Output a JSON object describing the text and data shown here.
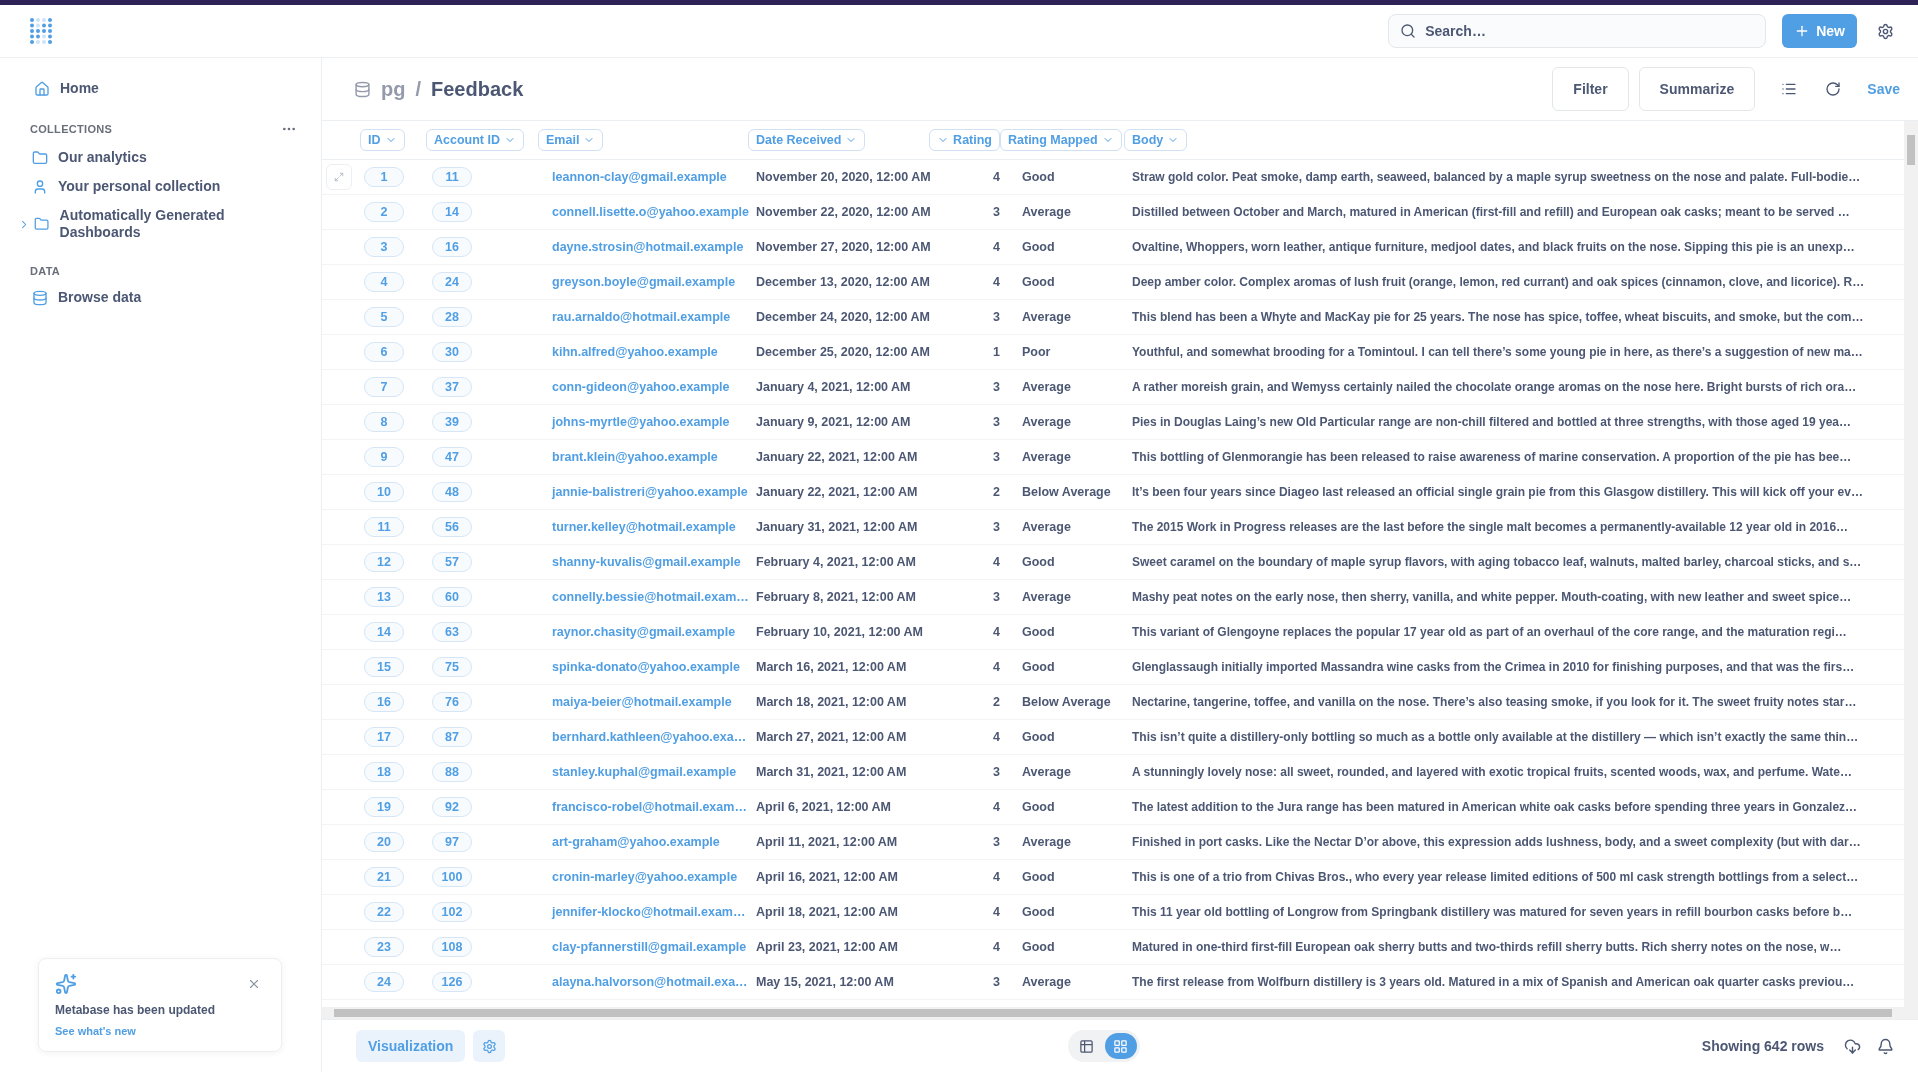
{
  "header": {
    "search": {
      "placeholder": "Search…"
    },
    "new_button": "New"
  },
  "sidebar": {
    "home": "Home",
    "sections": [
      {
        "title": "COLLECTIONS",
        "items": [
          {
            "label": "Our analytics",
            "kind": "folder",
            "has_children": false
          },
          {
            "label": "Your personal collection",
            "kind": "person",
            "has_children": false
          },
          {
            "label": "Automatically Generated Dashboards",
            "kind": "folder",
            "has_children": true
          }
        ]
      },
      {
        "title": "DATA",
        "items": [
          {
            "label": "Browse data",
            "kind": "database",
            "has_children": false
          }
        ]
      }
    ]
  },
  "toast": {
    "title": "Metabase has been updated",
    "link": "See what's new"
  },
  "title_bar": {
    "database": "pg",
    "separator": "/",
    "table": "Feedback",
    "buttons": [
      "Filter",
      "Summarize"
    ],
    "save": "Save"
  },
  "table": {
    "columns": [
      {
        "label": "ID",
        "kind": "text"
      },
      {
        "label": "Account ID",
        "kind": "text"
      },
      {
        "label": "Email",
        "kind": "text"
      },
      {
        "label": "Date Received",
        "kind": "text"
      },
      {
        "label": "Rating",
        "kind": "number"
      },
      {
        "label": "Rating Mapped",
        "kind": "text"
      },
      {
        "label": "Body",
        "kind": "text"
      }
    ],
    "rows": [
      {
        "hovered": true,
        "id": "1",
        "account_id": "11",
        "email": "leannon-clay@gmail.example",
        "date_received": "November 20, 2020, 12:00 AM",
        "rating": "4",
        "rating_mapped": "Good",
        "body": "Straw gold color. Peat smoke, damp earth, seaweed, balanced by a maple syrup sweetness on the nose and palate. Full-bodie…"
      },
      {
        "hovered": false,
        "id": "2",
        "account_id": "14",
        "email": "connell.lisette.o@yahoo.example",
        "date_received": "November 22, 2020, 12:00 AM",
        "rating": "3",
        "rating_mapped": "Average",
        "body": "Distilled between October and March, matured in American (first-fill and refill) and European oak casks; meant to be served …"
      },
      {
        "hovered": false,
        "id": "3",
        "account_id": "16",
        "email": "dayne.strosin@hotmail.example",
        "date_received": "November 27, 2020, 12:00 AM",
        "rating": "4",
        "rating_mapped": "Good",
        "body": "Ovaltine, Whoppers, worn leather, antique furniture, medjool dates, and black fruits on the nose. Sipping this pie is an unexp…"
      },
      {
        "hovered": false,
        "id": "4",
        "account_id": "24",
        "email": "greyson.boyle@gmail.example",
        "date_received": "December 13, 2020, 12:00 AM",
        "rating": "4",
        "rating_mapped": "Good",
        "body": "Deep amber color. Complex aromas of lush fruit (orange, lemon, red currant) and oak spices (cinnamon, clove, and licorice). R…"
      },
      {
        "hovered": false,
        "id": "5",
        "account_id": "28",
        "email": "rau.arnaldo@hotmail.example",
        "date_received": "December 24, 2020, 12:00 AM",
        "rating": "3",
        "rating_mapped": "Average",
        "body": "This blend has been a Whyte and MacKay pie for 25 years. The nose has spice, toffee, wheat biscuits, and smoke, but the com…"
      },
      {
        "hovered": false,
        "id": "6",
        "account_id": "30",
        "email": "kihn.alfred@yahoo.example",
        "date_received": "December 25, 2020, 12:00 AM",
        "rating": "1",
        "rating_mapped": "Poor",
        "body": "Youthful, and somewhat brooding for a Tomintoul. I can tell there’s some young pie in here, as there’s a suggestion of new ma…"
      },
      {
        "hovered": false,
        "id": "7",
        "account_id": "37",
        "email": "conn-gideon@yahoo.example",
        "date_received": "January 4, 2021, 12:00 AM",
        "rating": "3",
        "rating_mapped": "Average",
        "body": "A rather moreish grain, and Wemyss certainly nailed the chocolate orange aromas on the nose here. Bright bursts of rich ora…"
      },
      {
        "hovered": false,
        "id": "8",
        "account_id": "39",
        "email": "johns-myrtle@yahoo.example",
        "date_received": "January 9, 2021, 12:00 AM",
        "rating": "3",
        "rating_mapped": "Average",
        "body": "Pies in Douglas Laing’s new Old Particular range are non-chill filtered and bottled at three strengths, with those aged 19 yea…"
      },
      {
        "hovered": false,
        "id": "9",
        "account_id": "47",
        "email": "brant.klein@yahoo.example",
        "date_received": "January 22, 2021, 12:00 AM",
        "rating": "3",
        "rating_mapped": "Average",
        "body": "This bottling of Glenmorangie has been released to raise awareness of marine conservation. A proportion of the pie has bee…"
      },
      {
        "hovered": false,
        "id": "10",
        "account_id": "48",
        "email": "jannie-balistreri@yahoo.example",
        "date_received": "January 22, 2021, 12:00 AM",
        "rating": "2",
        "rating_mapped": "Below Average",
        "body": "It’s been four years since Diageo last released an official single grain pie from this Glasgow distillery. This will kick off your ev…"
      },
      {
        "hovered": false,
        "id": "11",
        "account_id": "56",
        "email": "turner.kelley@hotmail.example",
        "date_received": "January 31, 2021, 12:00 AM",
        "rating": "3",
        "rating_mapped": "Average",
        "body": "The 2015 Work in Progress releases are the last before the single malt becomes a permanently-available 12 year old in 2016…"
      },
      {
        "hovered": false,
        "id": "12",
        "account_id": "57",
        "email": "shanny-kuvalis@gmail.example",
        "date_received": "February 4, 2021, 12:00 AM",
        "rating": "4",
        "rating_mapped": "Good",
        "body": "Sweet caramel on the boundary of maple syrup flavors, with aging tobacco leaf, walnuts, malted barley, charcoal sticks, and s…"
      },
      {
        "hovered": false,
        "id": "13",
        "account_id": "60",
        "email": "connelly.bessie@hotmail.exam…",
        "date_received": "February 8, 2021, 12:00 AM",
        "rating": "3",
        "rating_mapped": "Average",
        "body": "Mashy peat notes on the early nose, then sherry, vanilla, and white pepper. Mouth-coating, with new leather and sweet spice…"
      },
      {
        "hovered": false,
        "id": "14",
        "account_id": "63",
        "email": "raynor.chasity@gmail.example",
        "date_received": "February 10, 2021, 12:00 AM",
        "rating": "4",
        "rating_mapped": "Good",
        "body": "This variant of Glengoyne replaces the popular 17 year old as part of an overhaul of the core range, and the maturation regi…"
      },
      {
        "hovered": false,
        "id": "15",
        "account_id": "75",
        "email": "spinka-donato@yahoo.example",
        "date_received": "March 16, 2021, 12:00 AM",
        "rating": "4",
        "rating_mapped": "Good",
        "body": "Glenglassaugh initially imported Massandra wine casks from the Crimea in 2010 for finishing purposes, and that was the firs…"
      },
      {
        "hovered": false,
        "id": "16",
        "account_id": "76",
        "email": "maiya-beier@hotmail.example",
        "date_received": "March 18, 2021, 12:00 AM",
        "rating": "2",
        "rating_mapped": "Below Average",
        "body": "Nectarine, tangerine, toffee, and vanilla on the nose. There’s also teasing smoke, if you look for it. The sweet fruity notes star…"
      },
      {
        "hovered": false,
        "id": "17",
        "account_id": "87",
        "email": "bernhard.kathleen@yahoo.exa…",
        "date_received": "March 27, 2021, 12:00 AM",
        "rating": "4",
        "rating_mapped": "Good",
        "body": "This isn’t quite a distillery-only bottling so much as a bottle only available at the distillery — which isn’t exactly the same thin…"
      },
      {
        "hovered": false,
        "id": "18",
        "account_id": "88",
        "email": "stanley.kuphal@gmail.example",
        "date_received": "March 31, 2021, 12:00 AM",
        "rating": "3",
        "rating_mapped": "Average",
        "body": "A stunningly lovely nose: all sweet, rounded, and layered with exotic tropical fruits, scented woods, wax, and perfume. Wate…"
      },
      {
        "hovered": false,
        "id": "19",
        "account_id": "92",
        "email": "francisco-robel@hotmail.exam…",
        "date_received": "April 6, 2021, 12:00 AM",
        "rating": "4",
        "rating_mapped": "Good",
        "body": "The latest addition to the Jura range has been matured in American white oak casks before spending three years in Gonzalez…"
      },
      {
        "hovered": false,
        "id": "20",
        "account_id": "97",
        "email": "art-graham@yahoo.example",
        "date_received": "April 11, 2021, 12:00 AM",
        "rating": "3",
        "rating_mapped": "Average",
        "body": "Finished in port casks. Like the Nectar D’or above, this expression adds lushness, body, and a sweet complexity (but with dar…"
      },
      {
        "hovered": false,
        "id": "21",
        "account_id": "100",
        "email": "cronin-marley@yahoo.example",
        "date_received": "April 16, 2021, 12:00 AM",
        "rating": "4",
        "rating_mapped": "Good",
        "body": "This is one of a trio from Chivas Bros., who every year release limited editions of 500 ml cask strength bottlings from a select…"
      },
      {
        "hovered": false,
        "id": "22",
        "account_id": "102",
        "email": "jennifer-klocko@hotmail.exam…",
        "date_received": "April 18, 2021, 12:00 AM",
        "rating": "4",
        "rating_mapped": "Good",
        "body": "This 11 year old bottling of Longrow from Springbank distillery was matured for seven years in refill bourbon casks before b…"
      },
      {
        "hovered": false,
        "id": "23",
        "account_id": "108",
        "email": "clay-pfannerstill@gmail.example",
        "date_received": "April 23, 2021, 12:00 AM",
        "rating": "4",
        "rating_mapped": "Good",
        "body": "Matured in one-third first-fill  European oak sherry butts and  two-thirds refill sherry butts. Rich  sherry notes on the nose, w…"
      },
      {
        "hovered": false,
        "id": "24",
        "account_id": "126",
        "email": "alayna.halvorson@hotmail.exa…",
        "date_received": "May 15, 2021, 12:00 AM",
        "rating": "3",
        "rating_mapped": "Average",
        "body": "The first release from Wolfburn distillery is 3 years old. Matured in a mix of Spanish and American oak quarter casks previou…"
      }
    ]
  },
  "footer": {
    "visualization_button": "Visualization",
    "views": [
      {
        "kind": "table",
        "selected": false
      },
      {
        "kind": "grid",
        "selected": true
      }
    ],
    "row_count": "Showing 642 rows"
  }
}
